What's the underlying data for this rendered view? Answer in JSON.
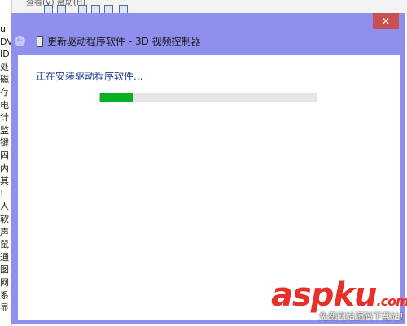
{
  "background_window": {
    "menu_text": "查看(V)  帮助(H)",
    "side_chars": [
      "u",
      "DV",
      "ID",
      "处",
      "磁",
      "存",
      "电",
      "计",
      "监",
      "键",
      "固",
      "内",
      "其",
      "!",
      "人",
      "软",
      "声",
      "鼠",
      "通",
      "图",
      "网",
      "系",
      "显"
    ]
  },
  "dialog": {
    "title": "更新驱动程序软件 - 3D 视频控制器",
    "close_glyph": "✕",
    "back_glyph": "←",
    "status": "正在安装驱动程序软件...",
    "progress_fraction": 0.15,
    "colors": {
      "frame": "#8f8fee",
      "progress_fill": "#06b025",
      "status_text": "#1d3d8f"
    }
  },
  "watermark": {
    "main": "aspku",
    "dot": ".com",
    "sub": "免费网站源码下载站!"
  }
}
